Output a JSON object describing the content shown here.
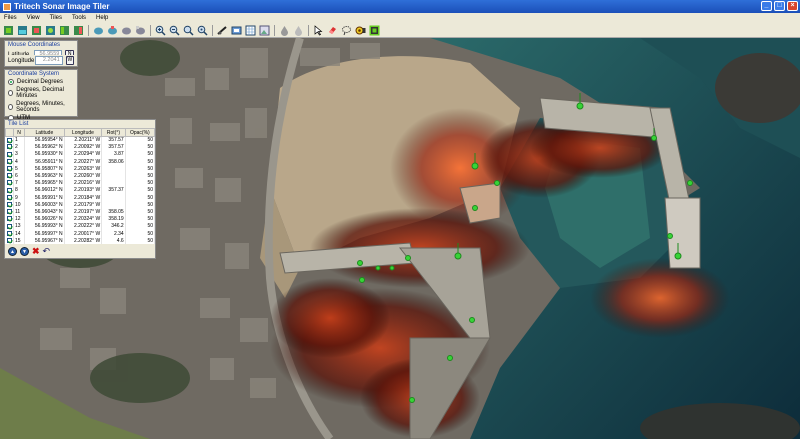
{
  "app": {
    "title": "Tritech Sonar Image Tiler"
  },
  "menu": [
    "Files",
    "View",
    "Tiles",
    "Tools",
    "Help"
  ],
  "toolbar": {
    "icons": [
      "tile-icon",
      "tile-icon",
      "tile-icon",
      "tile-icon",
      "tile-icon",
      "tile-icon",
      "tile-icon",
      "tile-icon",
      "tile-icon",
      "tile-icon",
      "zoom-in-icon",
      "zoom-out-icon",
      "zoom-fit-icon",
      "zoom-reset-icon",
      "sonar-icon",
      "layers-icon",
      "grid-icon",
      "image-icon",
      "droplet-icon",
      "droplet-icon",
      "pointer-icon",
      "eraser-icon",
      "lasso-icon",
      "sensor-icon",
      "select-icon"
    ]
  },
  "mouse": {
    "title": "Mouse Coordinates",
    "lat_label": "Latitude",
    "lat_value": "56.9559",
    "lat_btn": "N",
    "lon_label": "Longitude",
    "lon_value": "2.2041",
    "lon_btn": "W"
  },
  "coords": {
    "title": "Coordinate System",
    "options": [
      "Decimal Degrees",
      "Degrees, Decimal Minutes",
      "Degrees, Minutes, Seconds",
      "UTM"
    ],
    "selected_index": 0
  },
  "tiles": {
    "title": "Tile List",
    "headers": [
      "N",
      "Latitude",
      "Longitude",
      "Rot(°)",
      "Opac(%)"
    ],
    "rows": [
      [
        "1",
        "56.95954° N",
        "2.20211° W",
        "357.57",
        "50"
      ],
      [
        "2",
        "56.95962° N",
        "2.20092° W",
        "357.57",
        "50"
      ],
      [
        "3",
        "56.95930° N",
        "2.20294° W",
        "3.87",
        "50"
      ],
      [
        "4",
        "56.95911° N",
        "2.20227° W",
        "358.06",
        "50"
      ],
      [
        "5",
        "56.95807° N",
        "2.20263° W",
        "",
        "50"
      ],
      [
        "6",
        "56.95963° N",
        "2.20260° W",
        "",
        "50"
      ],
      [
        "7",
        "56.95965° N",
        "2.20216° W",
        "",
        "50"
      ],
      [
        "8",
        "56.96012° N",
        "2.20193° W",
        "357.37",
        "50"
      ],
      [
        "9",
        "56.95991° N",
        "2.20184° W",
        "",
        "50"
      ],
      [
        "10",
        "56.96003° N",
        "2.20179° W",
        "",
        "50"
      ],
      [
        "11",
        "56.96043° N",
        "2.20197° W",
        "358.05",
        "50"
      ],
      [
        "12",
        "56.96026° N",
        "2.20324° W",
        "358.19",
        "50"
      ],
      [
        "13",
        "56.95993° N",
        "2.20222° W",
        "346.2",
        "50"
      ],
      [
        "14",
        "56.95997° N",
        "2.20017° W",
        "2.34",
        "50"
      ],
      [
        "15",
        "56.95967° N",
        "2.20282° W",
        "4.6",
        "50"
      ]
    ]
  }
}
